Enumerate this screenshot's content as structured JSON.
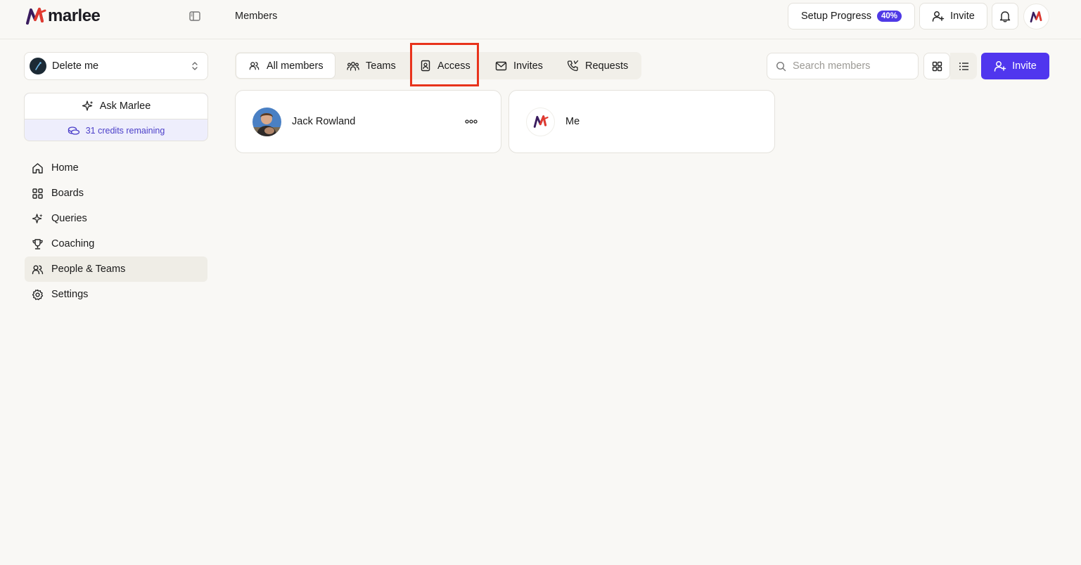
{
  "brand": {
    "name": "marlee",
    "accent": "#5036ee",
    "logo_colors": [
      "#e23a2f",
      "#8b1e6f",
      "#3a1c5e"
    ]
  },
  "header": {
    "breadcrumb": "Members",
    "setup_label": "Setup Progress",
    "setup_percent": "40%",
    "invite_label": "Invite",
    "icons": [
      "sidebar-toggle-icon",
      "bell-icon",
      "user-plus-icon"
    ]
  },
  "sidebar": {
    "workspace": "Delete me",
    "ask_label": "Ask Marlee",
    "credits": "31 credits remaining",
    "items": [
      {
        "label": "Home",
        "icon": "home-icon"
      },
      {
        "label": "Boards",
        "icon": "grid-icon"
      },
      {
        "label": "Queries",
        "icon": "sparkle-icon"
      },
      {
        "label": "Coaching",
        "icon": "trophy-icon"
      },
      {
        "label": "People & Teams",
        "icon": "people-icon",
        "active": true
      },
      {
        "label": "Settings",
        "icon": "gear-icon"
      }
    ]
  },
  "tabs": [
    {
      "label": "All members",
      "icon": "people-icon",
      "active": true
    },
    {
      "label": "Teams",
      "icon": "team-icon"
    },
    {
      "label": "Access",
      "icon": "badge-icon",
      "highlighted": true
    },
    {
      "label": "Invites",
      "icon": "envelope-icon"
    },
    {
      "label": "Requests",
      "icon": "phone-icon"
    }
  ],
  "search": {
    "placeholder": "Search members",
    "value": ""
  },
  "invite_button_label": "Invite",
  "members": [
    {
      "name": "Jack Rowland",
      "avatar": "photo"
    },
    {
      "name": "Me",
      "avatar": "marlee-logo"
    }
  ]
}
